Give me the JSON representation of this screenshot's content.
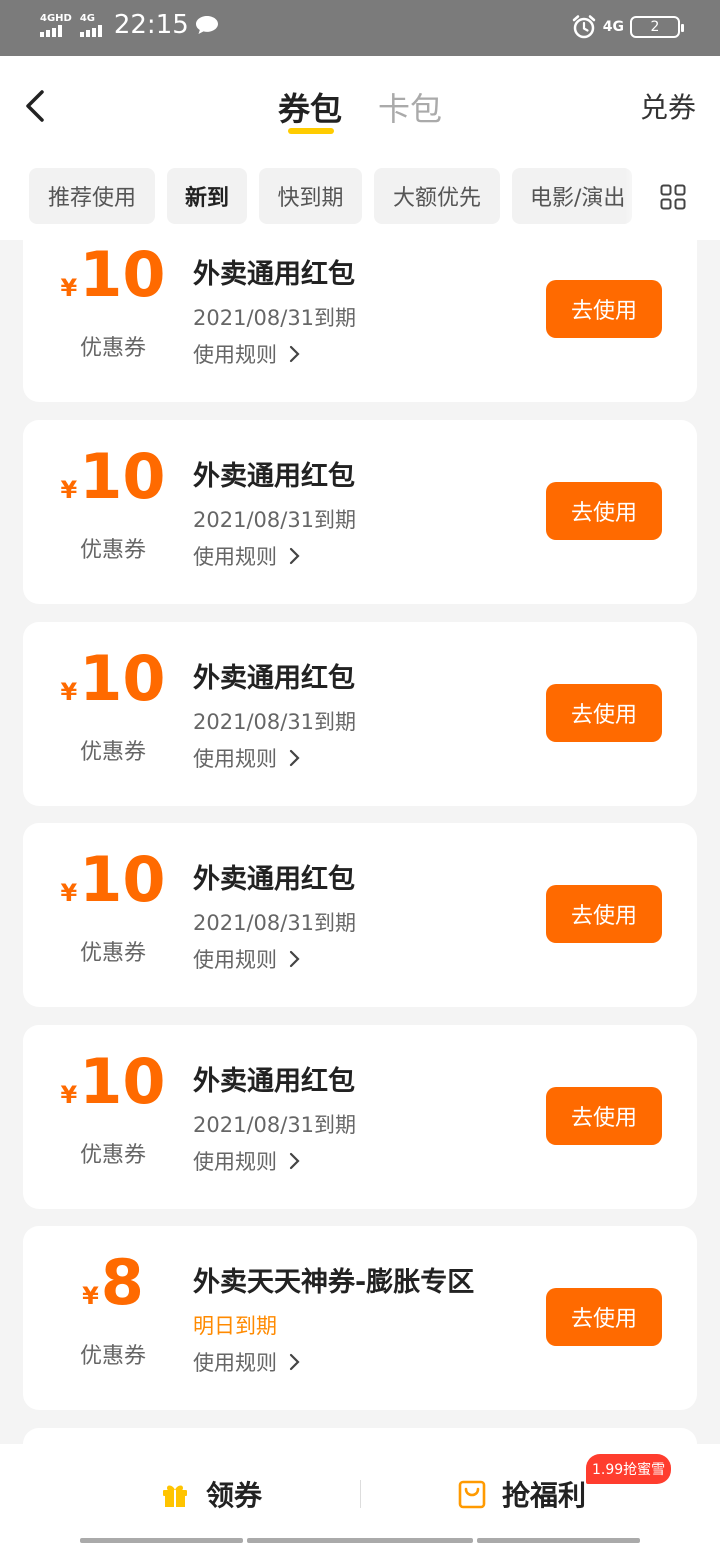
{
  "status": {
    "sim1": "4GHD",
    "sim2": "4G",
    "time": "22:15",
    "net": "4G",
    "battery": "2"
  },
  "header": {
    "tab_active": "券包",
    "tab_inactive": "卡包",
    "redeem": "兑券"
  },
  "filters": [
    "推荐使用",
    "新到",
    "快到期",
    "大额优先",
    "电影/演出"
  ],
  "coupons": [
    {
      "currency": "¥",
      "amount": "10",
      "label": "优惠券",
      "title": "外卖通用红包",
      "expiry": "2021/08/31到期",
      "rules": "使用规则",
      "button": "去使用"
    },
    {
      "currency": "¥",
      "amount": "10",
      "label": "优惠券",
      "title": "外卖通用红包",
      "expiry": "2021/08/31到期",
      "rules": "使用规则",
      "button": "去使用"
    },
    {
      "currency": "¥",
      "amount": "10",
      "label": "优惠券",
      "title": "外卖通用红包",
      "expiry": "2021/08/31到期",
      "rules": "使用规则",
      "button": "去使用"
    },
    {
      "currency": "¥",
      "amount": "10",
      "label": "优惠券",
      "title": "外卖通用红包",
      "expiry": "2021/08/31到期",
      "rules": "使用规则",
      "button": "去使用"
    },
    {
      "currency": "¥",
      "amount": "10",
      "label": "优惠券",
      "title": "外卖通用红包",
      "expiry": "2021/08/31到期",
      "rules": "使用规则",
      "button": "去使用"
    },
    {
      "currency": "¥",
      "amount": "8",
      "label": "优惠券",
      "title": "外卖天天神券-膨胀专区",
      "expiry": "明日到期",
      "rules": "使用规则",
      "button": "去使用"
    }
  ],
  "bottom": {
    "get_coupons": "领券",
    "grab_benefits": "抢福利",
    "promo_badge": "1.99抢蜜雪"
  },
  "colors": {
    "accent": "#ff6a00",
    "tab_underline": "#ffcc00",
    "expiry_soon": "#ff8a00"
  }
}
